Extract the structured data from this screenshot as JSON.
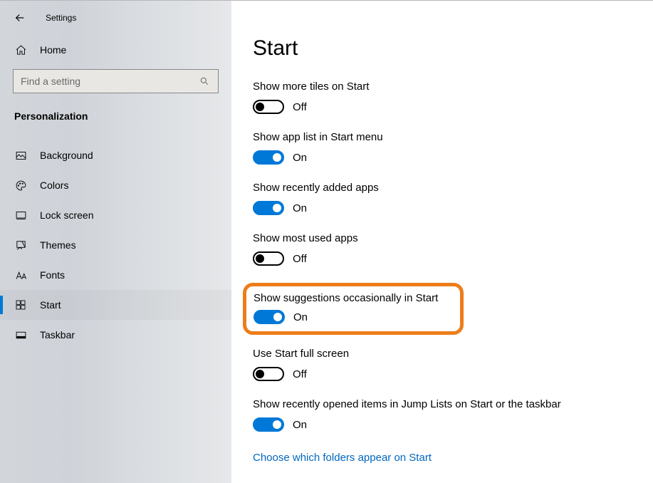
{
  "app_title": "Settings",
  "home_label": "Home",
  "search_placeholder": "Find a setting",
  "section_label": "Personalization",
  "nav": [
    {
      "label": "Background"
    },
    {
      "label": "Colors"
    },
    {
      "label": "Lock screen"
    },
    {
      "label": "Themes"
    },
    {
      "label": "Fonts"
    },
    {
      "label": "Start"
    },
    {
      "label": "Taskbar"
    }
  ],
  "page_title": "Start",
  "state_on": "On",
  "state_off": "Off",
  "settings": {
    "more_tiles": {
      "label": "Show more tiles on Start",
      "on": false
    },
    "app_list": {
      "label": "Show app list in Start menu",
      "on": true
    },
    "recently_added": {
      "label": "Show recently added apps",
      "on": true
    },
    "most_used": {
      "label": "Show most used apps",
      "on": false
    },
    "suggestions": {
      "label": "Show suggestions occasionally in Start",
      "on": true
    },
    "full_screen": {
      "label": "Use Start full screen",
      "on": false
    },
    "jump_lists": {
      "label": "Show recently opened items in Jump Lists on Start or the taskbar",
      "on": true
    }
  },
  "link_choose_folders": "Choose which folders appear on Start"
}
